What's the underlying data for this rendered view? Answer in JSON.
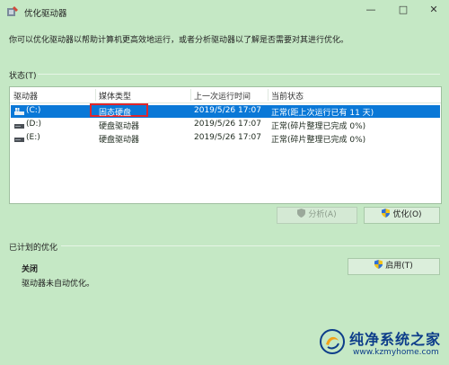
{
  "window": {
    "title": "优化驱动器",
    "minimize": "—",
    "maximize": "□",
    "close": "✕",
    "icon": "defrag-app-icon"
  },
  "description": "你可以优化驱动器以帮助计算机更高效地运行，或者分析驱动器以了解是否需要对其进行优化。",
  "status": {
    "label": "状态(T)",
    "columns": [
      "驱动器",
      "媒体类型",
      "上一次运行时间",
      "当前状态"
    ],
    "rows": [
      {
        "drive": "(C:)",
        "media": "固态硬盘",
        "last_run": "2019/5/26 17:07",
        "status": "正常(距上次运行已有 11 天)",
        "selected": true,
        "icon": "windows-drive-icon"
      },
      {
        "drive": "(D:)",
        "media": "硬盘驱动器",
        "last_run": "2019/5/26 17:07",
        "status": "正常(碎片整理已完成 0%)",
        "selected": false,
        "icon": "drive-icon"
      },
      {
        "drive": "(E:)",
        "media": "硬盘驱动器",
        "last_run": "2019/5/26 17:07",
        "status": "正常(碎片整理已完成 0%)",
        "selected": false,
        "icon": "drive-icon"
      }
    ]
  },
  "buttons": {
    "analyze": "分析(A)",
    "optimize": "优化(O)",
    "enable": "启用(T)"
  },
  "scheduled": {
    "label": "已计划的优化",
    "state": "关闭",
    "detail": "驱动器未自动优化。"
  },
  "watermark": {
    "text": "纯净系统之家",
    "url": "www.kzmyhome.com"
  },
  "colors": {
    "background": "#c5e8c5",
    "selection": "#0a78d7",
    "highlight_box": "#e0262b",
    "watermark": "#0d3d8a"
  }
}
